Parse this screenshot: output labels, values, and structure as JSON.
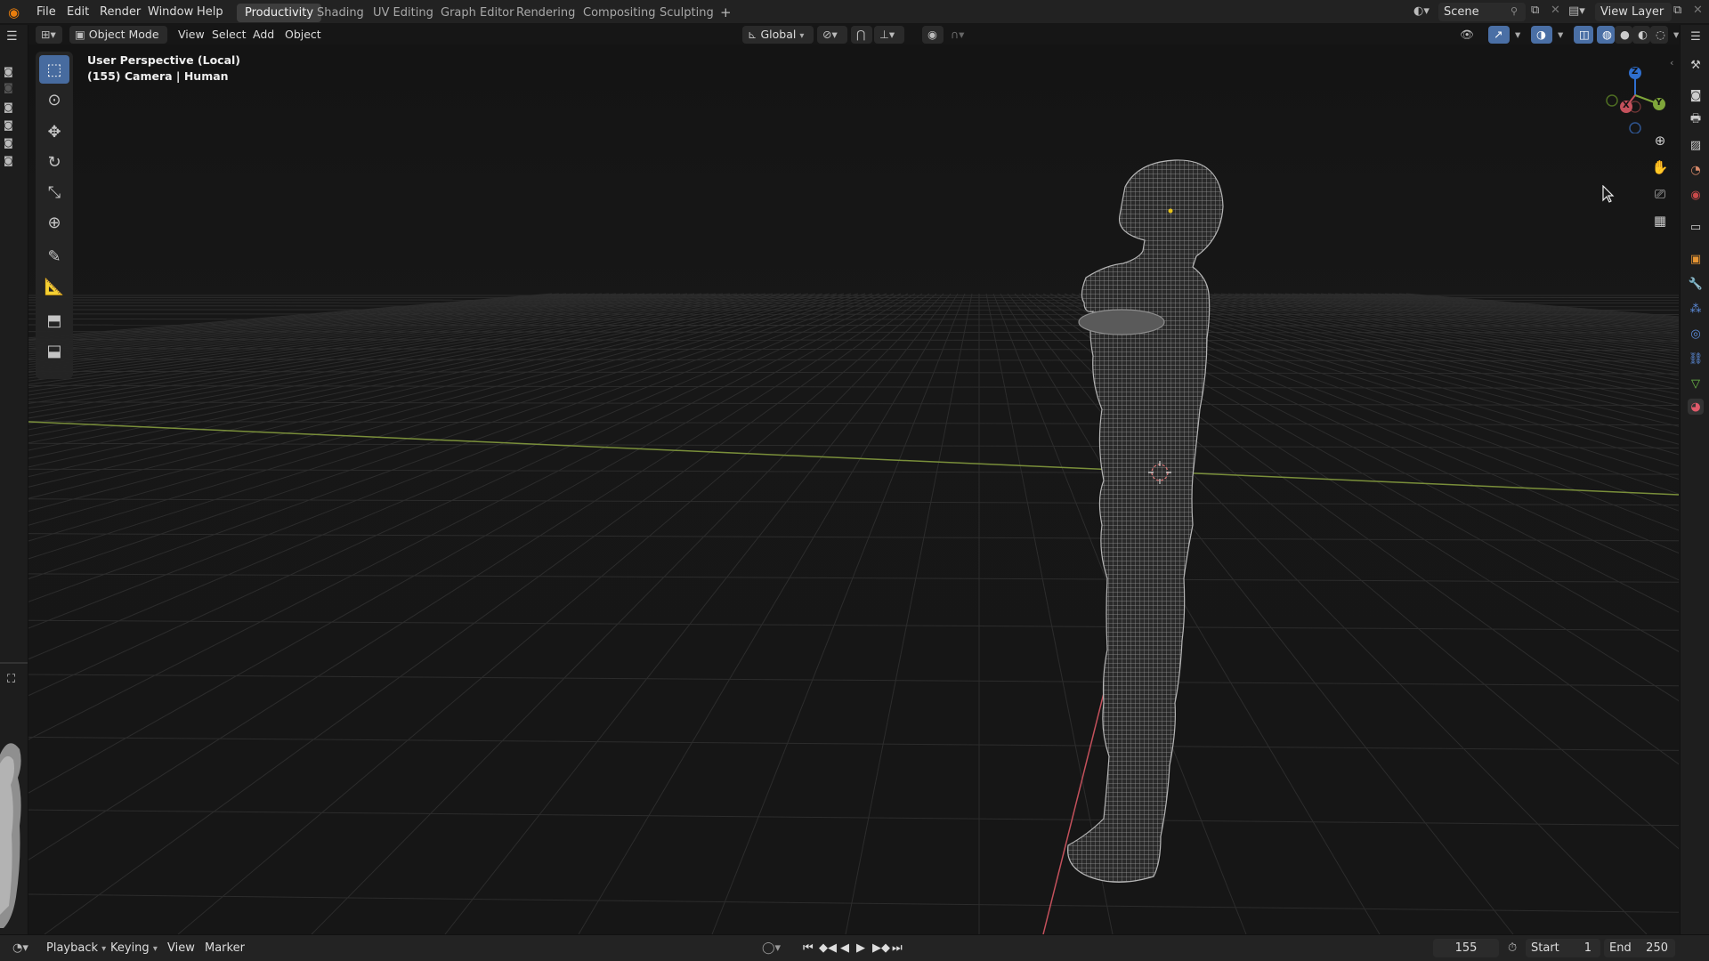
{
  "menubar": {
    "items": [
      "File",
      "Edit",
      "Render",
      "Window",
      "Help"
    ],
    "workspaces": [
      "Productivity",
      "Shading",
      "UV Editing",
      "Graph Editor",
      "Rendering",
      "Compositing",
      "Sculpting"
    ],
    "active_workspace": "Productivity",
    "add_tab": "+",
    "scene_name": "Scene",
    "view_layer": "View Layer"
  },
  "header3d": {
    "mode": "Object Mode",
    "menus": [
      "View",
      "Select",
      "Add",
      "Object"
    ],
    "orientation": "Global"
  },
  "viewport": {
    "perspective_label": "User Perspective (Local)",
    "object_label": "(155) Camera | Human"
  },
  "gizmo": {
    "z": "Z",
    "x": "X",
    "y": "Y"
  },
  "timeline": {
    "menus": [
      "Playback",
      "Keying",
      "View",
      "Marker"
    ],
    "current_frame": "155",
    "start_label": "Start",
    "start_value": "1",
    "end_label": "End",
    "end_value": "250"
  },
  "colors": {
    "accent": "#4a6fa5",
    "x_axis": "#c4515c",
    "y_axis": "#7fa63a",
    "z_axis": "#2f6fcf"
  }
}
